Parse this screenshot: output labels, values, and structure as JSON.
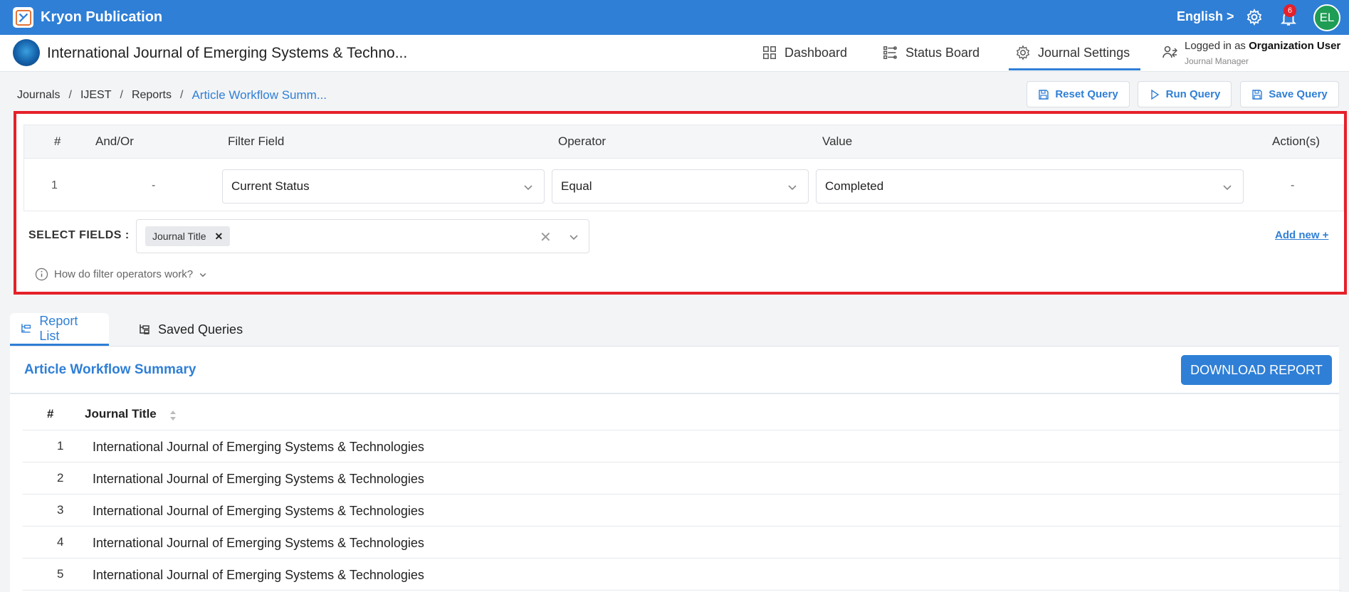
{
  "topbar": {
    "app_title": "Kryon Publication",
    "language": "English >",
    "notification_count": "6",
    "avatar_initials": "EL"
  },
  "header": {
    "journal_title": "International Journal of Emerging Systems & Techno...",
    "nav": [
      {
        "label": "Dashboard",
        "icon": "grid-icon"
      },
      {
        "label": "Status Board",
        "icon": "status-board-icon"
      },
      {
        "label": "Journal Settings",
        "icon": "gear-icon",
        "active": true
      }
    ],
    "logged_in_prefix": "Logged in as",
    "logged_in_user": "Organization User",
    "role": "Journal Manager"
  },
  "breadcrumb": {
    "items": [
      "Journals",
      "IJEST",
      "Reports"
    ],
    "current": "Article Workflow Summ..."
  },
  "query_buttons": {
    "reset": "Reset Query",
    "run": "Run Query",
    "save": "Save Query"
  },
  "filter": {
    "headers": {
      "num": "#",
      "andor": "And/Or",
      "field": "Filter Field",
      "operator": "Operator",
      "value": "Value",
      "actions": "Action(s)"
    },
    "rows": [
      {
        "num": "1",
        "andor": "-",
        "field": "Current Status",
        "operator": "Equal",
        "value": "Completed",
        "actions": "-"
      }
    ],
    "select_fields_label": "SELECT FIELDS :",
    "selected_chip": "Journal Title",
    "add_new": "Add new +",
    "help_text": "How do filter operators work?"
  },
  "tabs": {
    "report_list": "Report List",
    "saved_queries": "Saved Queries"
  },
  "report": {
    "title": "Article Workflow Summary",
    "download_label": "DOWNLOAD REPORT",
    "columns": {
      "num": "#",
      "title": "Journal Title"
    },
    "rows": [
      {
        "num": "1",
        "title": "International Journal of Emerging Systems & Technologies"
      },
      {
        "num": "2",
        "title": "International Journal of Emerging Systems & Technologies"
      },
      {
        "num": "3",
        "title": "International Journal of Emerging Systems & Technologies"
      },
      {
        "num": "4",
        "title": "International Journal of Emerging Systems & Technologies"
      },
      {
        "num": "5",
        "title": "International Journal of Emerging Systems & Technologies"
      }
    ]
  },
  "colors": {
    "accent": "#2f7fd6",
    "highlight": "#e5202a",
    "avatar": "#1f9d55"
  }
}
